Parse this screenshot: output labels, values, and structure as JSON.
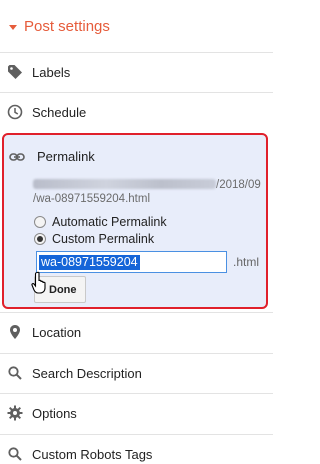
{
  "header": {
    "title": "Post settings"
  },
  "menu": {
    "labels": "Labels",
    "schedule": "Schedule",
    "location": "Location",
    "search_description": "Search Description",
    "options": "Options",
    "custom_robots_tags": "Custom Robots Tags"
  },
  "permalink": {
    "title": "Permalink",
    "url_line1_tail": "/2018/09",
    "url_line2": "/wa-08971559204.html",
    "options": [
      "Automatic Permalink",
      "Custom Permalink"
    ],
    "selected_option": "Custom Permalink",
    "input_value": "wa-08971559204",
    "suffix": ".html",
    "done_label": "Done"
  },
  "colors": {
    "accent": "#e65c3b",
    "highlight_border": "#e0202b",
    "panel_bg": "#e8edfa",
    "selection": "#1565d8"
  },
  "icons": [
    "caret-down-icon",
    "tag-icon",
    "clock-icon",
    "link-icon",
    "location-pin-icon",
    "search-icon",
    "gear-icon",
    "search-icon"
  ]
}
